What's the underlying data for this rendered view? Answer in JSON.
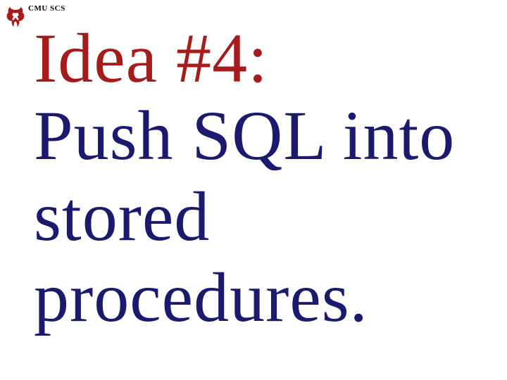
{
  "header": {
    "org_text": "CMU SCS",
    "logo_color": "#a61c1c"
  },
  "content": {
    "line1": "Idea #4:",
    "line2": "Push SQL into",
    "line3": "stored procedures."
  },
  "colors": {
    "accent_red": "#a61c1c",
    "body_navy": "#1a1a6e"
  }
}
